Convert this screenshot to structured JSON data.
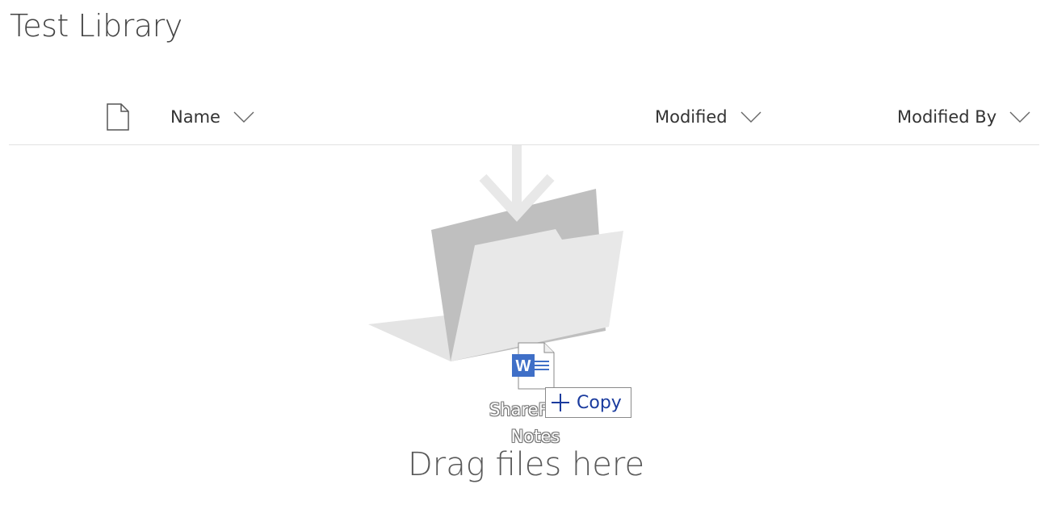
{
  "library": {
    "title": "Test Library"
  },
  "columns": {
    "filetype_icon": "document-icon",
    "name_label": "Name",
    "modified_label": "Modified",
    "modified_by_label": "Modified By",
    "sort_icon": "chevron-down-icon"
  },
  "empty_state": {
    "illustration": "folder-drop-icon",
    "message": "Drag files here"
  },
  "drag": {
    "file_icon": "word-document-icon",
    "file_name_visible": "ShareF",
    "file_name_line2": "Notes",
    "action_label": "Copy",
    "action_icon": "plus-icon"
  },
  "colors": {
    "copy_text": "#1a3b9e",
    "word_blue": "#3f6fc7",
    "folder_back": "#bdbdbd",
    "folder_front": "#e6e6e6"
  }
}
